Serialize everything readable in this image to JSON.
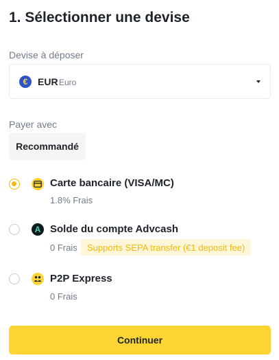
{
  "title": "1. Sélectionner une devise",
  "deposit": {
    "label": "Devise à déposer",
    "currency_code": "EUR",
    "currency_name": "Euro",
    "currency_symbol": "€"
  },
  "pay": {
    "label": "Payer avec",
    "tab": "Recommandé"
  },
  "methods": [
    {
      "name": "Carte bancaire (VISA/MC)",
      "fee": "1.8% Frais",
      "selected": true
    },
    {
      "name": "Solde du compte Advcash",
      "fee": "0 Frais",
      "tag": "Supports SEPA transfer (€1 deposit fee)",
      "selected": false,
      "icon_letter": "A"
    },
    {
      "name": "P2P Express",
      "fee": "0 Frais",
      "selected": false
    }
  ],
  "continue_label": "Continuer",
  "colors": {
    "accent": "#fcd535",
    "radio_selected": "#f0b90b",
    "tag_bg": "#fef6d8"
  }
}
